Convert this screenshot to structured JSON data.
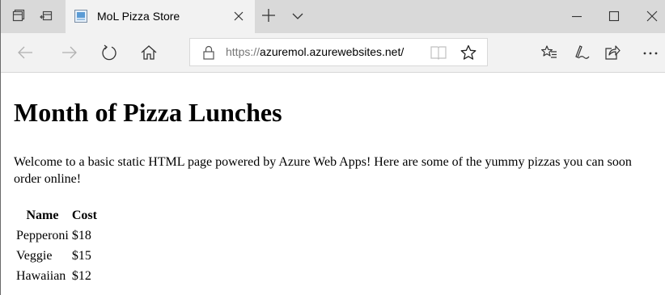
{
  "browser": {
    "tab": {
      "title": "MoL Pizza Store"
    },
    "address_bar": {
      "protocol": "https://",
      "host": "azuremol.azurewebsites.net/"
    }
  },
  "page": {
    "heading": "Month of Pizza Lunches",
    "intro": "Welcome to a basic static HTML page powered by Azure Web Apps! Here are some of the yummy pizzas you can soon order online!",
    "table": {
      "headers": [
        "Name",
        "Cost"
      ],
      "rows": [
        [
          "Pepperoni",
          "$18"
        ],
        [
          "Veggie",
          "$15"
        ],
        [
          "Hawaiian",
          "$12"
        ]
      ]
    }
  },
  "icons": {
    "tab_strip": [
      "tab-aside-icon",
      "back-tab-icon",
      "favicon-icon",
      "close-icon",
      "plus-icon",
      "chevron-down-icon"
    ],
    "window": [
      "minimize-icon",
      "maximize-icon",
      "close-icon"
    ],
    "nav": [
      "back-arrow-icon",
      "forward-arrow-icon",
      "refresh-icon",
      "home-icon",
      "lock-icon",
      "reading-view-icon",
      "star-icon",
      "favorites-icon",
      "pen-icon",
      "share-icon",
      "more-icon"
    ]
  },
  "colors": {
    "tab_strip": "#d9d9d9",
    "active_tab": "#f2f2f2",
    "nav_bar": "#f2f2f2",
    "url_protocol": "#767676",
    "page_background": "#ffffff"
  }
}
